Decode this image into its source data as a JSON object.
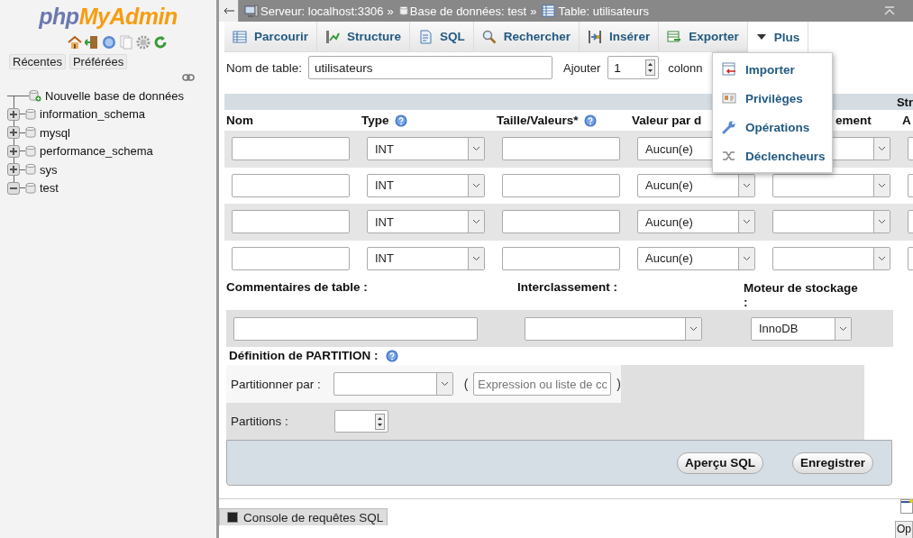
{
  "logo": {
    "prefix": "php",
    "suffix": "MyAdmin"
  },
  "sidebar": {
    "tabs": [
      {
        "label": "Récentes"
      },
      {
        "label": "Préférées"
      }
    ],
    "tree": [
      {
        "label": "Nouvelle base de données",
        "kind": "new"
      },
      {
        "label": "information_schema",
        "kind": "database",
        "expanded": false
      },
      {
        "label": "mysql",
        "kind": "database",
        "expanded": false
      },
      {
        "label": "performance_schema",
        "kind": "database",
        "expanded": false
      },
      {
        "label": "sys",
        "kind": "database",
        "expanded": false
      },
      {
        "label": "test",
        "kind": "database",
        "expanded": true
      }
    ]
  },
  "breadcrumb": {
    "separator": "»",
    "items": [
      {
        "label": "Serveur: localhost:3306",
        "kind": "server"
      },
      {
        "label": "Base de données: test",
        "kind": "database"
      },
      {
        "label": "Table: utilisateurs",
        "kind": "table"
      }
    ]
  },
  "tabs": [
    {
      "label": "Parcourir",
      "kind": "browse",
      "selected": false
    },
    {
      "label": "Structure",
      "kind": "structure",
      "selected": false
    },
    {
      "label": "SQL",
      "kind": "sql",
      "selected": false
    },
    {
      "label": "Rechercher",
      "kind": "search",
      "selected": false
    },
    {
      "label": "Insérer",
      "kind": "insert",
      "selected": false
    },
    {
      "label": "Exporter",
      "kind": "export",
      "selected": false
    },
    {
      "label": "Plus",
      "kind": "more",
      "selected": false,
      "expanded": true
    }
  ],
  "more_menu": [
    {
      "label": "Importer",
      "kind": "import"
    },
    {
      "label": "Privilèges",
      "kind": "privileges"
    },
    {
      "label": "Opérations",
      "kind": "operations"
    },
    {
      "label": "Déclencheurs",
      "kind": "triggers"
    }
  ],
  "form": {
    "table_name_label": "Nom de table:",
    "table_name": "utilisateurs",
    "add_label": "Ajouter",
    "add_count": "1",
    "add_suffix": "colonn"
  },
  "header_bar": {
    "text": "Str"
  },
  "columns": [
    {
      "label": "Nom",
      "help": false
    },
    {
      "label": "Type",
      "help": true
    },
    {
      "label": "Taille/Valeurs*",
      "help": true
    },
    {
      "label": "Valeur par d",
      "help": false
    },
    {
      "label": "ement",
      "help": false
    },
    {
      "label": "A"
    }
  ],
  "rows": [
    {
      "type": "INT",
      "default": "Aucun(e)"
    },
    {
      "type": "INT",
      "default": "Aucun(e)"
    },
    {
      "type": "INT",
      "default": "Aucun(e)"
    },
    {
      "type": "INT",
      "default": "Aucun(e)"
    }
  ],
  "table_options": {
    "comments_label": "Commentaires de table :",
    "collation_label": "Interclassement :",
    "engine_label": "Moteur de stockage :",
    "engine": "InnoDB"
  },
  "partition": {
    "title": "Définition de PARTITION :",
    "by_label": "Partitionner par :",
    "open_paren": "(",
    "expression_placeholder": "Expression ou liste de co",
    "close_paren": ")",
    "count_label": "Partitions :"
  },
  "buttons": [
    {
      "label": "Aperçu SQL"
    },
    {
      "label": "Enregistrer"
    }
  ],
  "console": {
    "label": "Console de requêtes SQL"
  },
  "corner_text": "Op"
}
